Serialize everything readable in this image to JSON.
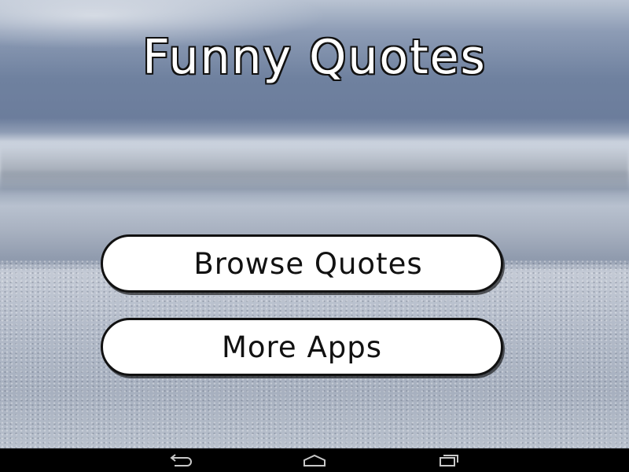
{
  "app": {
    "title": "Funny Quotes"
  },
  "menu": {
    "browse_label": "Browse Quotes",
    "more_apps_label": "More Apps"
  },
  "navbar": {
    "icons": [
      "back-icon",
      "home-icon",
      "recents-icon"
    ],
    "icon_color": "#c8c8c8",
    "background": "#000000"
  },
  "colors": {
    "button_fill": "#ffffff",
    "button_border": "#111111",
    "title_fill": "#ffffff",
    "title_outline": "#111111"
  }
}
